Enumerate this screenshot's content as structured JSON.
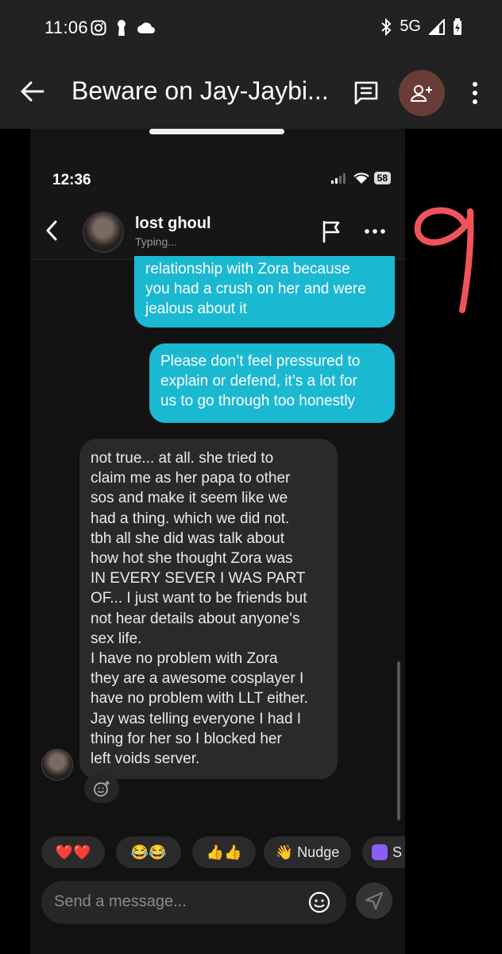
{
  "system_status": {
    "time": "11:06",
    "network": "5G"
  },
  "app_bar": {
    "title": "Beware on Jay-Jaybi..."
  },
  "embedded": {
    "status": {
      "time": "12:36",
      "battery": "58"
    },
    "chat_header": {
      "name": "lost ghoul",
      "status": "Typing..."
    },
    "messages": [
      {
        "direction": "outgoing",
        "lines": [
          "relationship with Zora because",
          "you had a crush on her and were",
          "jealous about it"
        ]
      },
      {
        "direction": "outgoing",
        "lines": [
          "Please don’t feel pressured to",
          "explain or defend, it’s a lot for",
          "us to go through too honestly"
        ]
      },
      {
        "direction": "incoming",
        "lines": [
          "not true... at all. she tried to",
          "claim me as her papa to other",
          "sos and make it seem like we",
          "had a thing. which we did not.",
          "tbh all she did was talk about",
          "how hot she thought Zora was",
          "IN EVERY SEVER I WAS PART",
          "OF... I just want to be friends but",
          "not hear details about anyone's",
          "sex life.",
          "I have no problem with Zora",
          "they are a awesome cosplayer I",
          "have no problem with LLT either.",
          "Jay was telling everyone I had I",
          "thing for her so I blocked her",
          "left voids server."
        ]
      }
    ],
    "quick_replies": [
      {
        "label": "❤️❤️"
      },
      {
        "label": "😂😂"
      },
      {
        "label": "👍👍"
      },
      {
        "label": "👋 Nudge"
      },
      {
        "label": "S"
      }
    ],
    "composer": {
      "placeholder": "Send a message..."
    }
  },
  "annotation": {
    "page_number": "9",
    "color": "#f0535a"
  },
  "colors": {
    "outgoing_bubble": "#1bb8d2",
    "incoming_bubble": "#2a2a2a",
    "app_bar": "#222222",
    "add_person_button": "#6a3c37"
  }
}
